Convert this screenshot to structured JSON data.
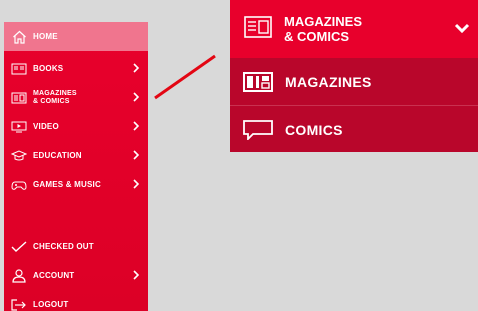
{
  "sidebar": {
    "items": [
      {
        "label": "HOME"
      },
      {
        "label": "BOOKS"
      },
      {
        "label": "MAGAZINES\n& COMICS"
      },
      {
        "label": "VIDEO"
      },
      {
        "label": "EDUCATION"
      },
      {
        "label": "GAMES & MUSIC"
      },
      {
        "label": "CHECKED OUT"
      },
      {
        "label": "ACCOUNT"
      },
      {
        "label": "LOGOUT"
      }
    ]
  },
  "popup": {
    "header_label": "MAGAZINES\n& COMICS",
    "items": [
      {
        "label": "MAGAZINES"
      },
      {
        "label": "COMICS"
      }
    ]
  },
  "colors": {
    "primary_red": "#e8002c",
    "dark_red": "#b9062b",
    "home_highlight": "#f0758e",
    "connector_red": "#e30613"
  }
}
